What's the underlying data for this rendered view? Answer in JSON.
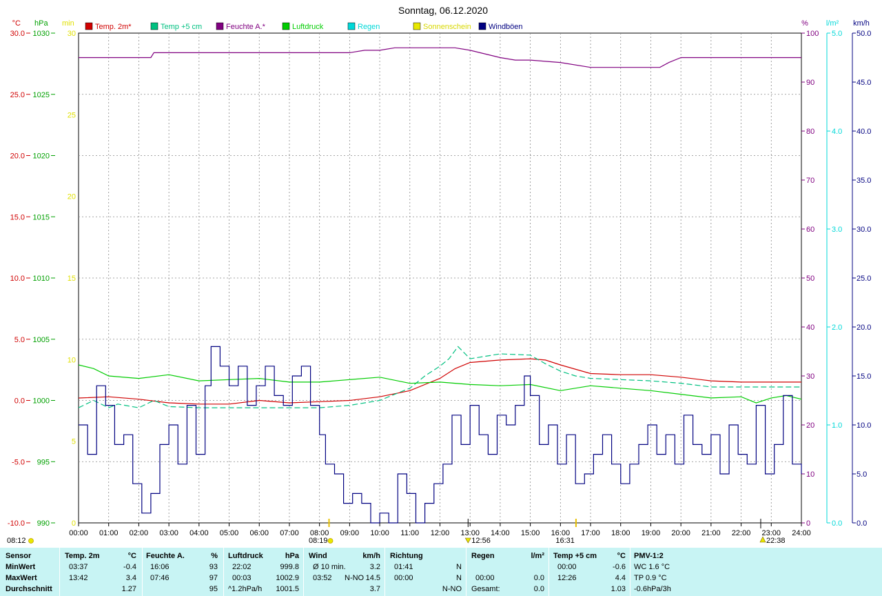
{
  "chart_data": {
    "type": "line",
    "title": "Sonntag, 06.12.2020",
    "legend": [
      {
        "name": "Temp. 2m*",
        "color": "#d00000"
      },
      {
        "name": "Temp +5 cm",
        "color": "#00c080"
      },
      {
        "name": "Feuchte A.*",
        "color": "#800080"
      },
      {
        "name": "Luftdruck",
        "color": "#00cc00"
      },
      {
        "name": "Regen",
        "color": "#00d8d8"
      },
      {
        "name": "Sonnenschein",
        "color": "#e8e800"
      },
      {
        "name": "Windböen",
        "color": "#000080"
      }
    ],
    "axes": {
      "temp": {
        "unit": "°C",
        "color": "#d00000",
        "min": -10,
        "max": 30,
        "ticks": [
          "30.0",
          "25.0",
          "20.0",
          "15.0",
          "10.0",
          "5.0",
          "0.0",
          "-5.0",
          "-10.0"
        ]
      },
      "pressure": {
        "unit": "hPa",
        "color": "#00a000",
        "min": 990,
        "max": 1030,
        "ticks": [
          "1030",
          "1025",
          "1020",
          "1015",
          "1010",
          "1005",
          "1000",
          "995",
          "990"
        ]
      },
      "sunshine": {
        "unit": "min",
        "color": "#e0e000",
        "min": 0,
        "max": 30,
        "ticks": [
          "30",
          "25",
          "20",
          "15",
          "10",
          "5",
          "0"
        ]
      },
      "humidity": {
        "unit": "%",
        "color": "#800080",
        "min": 0,
        "max": 100,
        "ticks": [
          "100",
          "90",
          "80",
          "70",
          "60",
          "50",
          "40",
          "30",
          "20",
          "10",
          "0"
        ]
      },
      "rain": {
        "unit": "l/m²",
        "color": "#00d8d8",
        "min": 0,
        "max": 5,
        "ticks": [
          "5.0",
          "4.0",
          "3.0",
          "2.0",
          "1.0",
          "0.0"
        ]
      },
      "wind": {
        "unit": "km/h",
        "color": "#000080",
        "min": 0,
        "max": 50,
        "ticks": [
          "50.0",
          "45.0",
          "40.0",
          "35.0",
          "30.0",
          "25.0",
          "20.0",
          "15.0",
          "10.0",
          "5.0",
          "0.0"
        ]
      }
    },
    "x_ticks": [
      "00:00",
      "01:00",
      "02:00",
      "03:00",
      "04:00",
      "05:00",
      "06:00",
      "07:00",
      "08:00",
      "09:00",
      "10:00",
      "11:00",
      "12:00",
      "13:00",
      "14:00",
      "15:00",
      "16:00",
      "17:00",
      "18:00",
      "19:00",
      "20:00",
      "21:00",
      "22:00",
      "23:00",
      "24:00"
    ],
    "markers": {
      "sunrise": "08:19",
      "noon": "12:56",
      "sunset": "16:31",
      "moonrise": "22:38",
      "left_label": "08:12"
    },
    "series": [
      {
        "name": "Temp. 2m*",
        "axis": "temp",
        "color": "#d00000",
        "x": [
          0,
          1,
          2,
          3,
          4,
          5,
          6,
          7,
          8,
          9,
          10,
          11,
          12,
          12.5,
          13,
          14,
          15,
          15.5,
          16,
          17,
          18,
          19,
          20,
          21,
          22,
          23,
          24
        ],
        "y": [
          0.2,
          0.3,
          0.1,
          -0.2,
          -0.3,
          -0.3,
          0.0,
          -0.2,
          -0.1,
          0.0,
          0.3,
          0.8,
          1.8,
          2.6,
          3.1,
          3.3,
          3.4,
          3.3,
          2.9,
          2.2,
          2.1,
          2.1,
          1.9,
          1.6,
          1.5,
          1.5,
          1.5
        ]
      },
      {
        "name": "Temp +5 cm",
        "axis": "temp",
        "color": "#00c080",
        "dashed": true,
        "x": [
          0,
          0.5,
          1,
          1.3,
          2,
          2.5,
          3,
          4,
          5,
          6,
          7,
          8,
          9,
          10,
          10.5,
          11,
          11.5,
          12,
          12.3,
          12.6,
          13,
          14,
          15,
          15.5,
          16,
          16.5,
          17,
          18,
          19,
          20,
          21,
          22,
          23,
          24
        ],
        "y": [
          -0.6,
          0.0,
          -0.6,
          -0.3,
          -0.6,
          0.0,
          -0.5,
          -0.6,
          -0.6,
          -0.6,
          -0.6,
          -0.6,
          -0.4,
          0.0,
          0.5,
          1.0,
          2.0,
          2.8,
          3.4,
          4.4,
          3.4,
          3.8,
          3.7,
          3.0,
          2.4,
          2.0,
          1.8,
          1.7,
          1.6,
          1.4,
          1.1,
          1.1,
          1.1,
          1.1
        ]
      },
      {
        "name": "Feuchte A.*",
        "axis": "humidity",
        "color": "#800080",
        "x": [
          0,
          1,
          2,
          2.4,
          2.5,
          3,
          4,
          5,
          6,
          7,
          8,
          9,
          9.5,
          10,
          10.5,
          11,
          12,
          12.5,
          13,
          14,
          14.5,
          15,
          16,
          17,
          18,
          19,
          19.3,
          19.6,
          20,
          21,
          22,
          23,
          24
        ],
        "y": [
          95,
          95,
          95,
          95,
          96,
          96,
          96,
          96,
          96,
          96,
          96,
          96,
          96.5,
          96.5,
          97,
          97,
          97,
          97,
          96.5,
          95,
          94.5,
          94.5,
          94,
          93,
          93,
          93,
          93,
          94,
          95,
          95,
          95,
          95,
          95
        ]
      },
      {
        "name": "Luftdruck",
        "axis": "pressure",
        "color": "#00cc00",
        "x": [
          0,
          0.5,
          1,
          2,
          3,
          4,
          5,
          6,
          7,
          8,
          9,
          10,
          11,
          12,
          13,
          14,
          15,
          16,
          17,
          18,
          19,
          20,
          21,
          22,
          22.5,
          23,
          23.5,
          24
        ],
        "y": [
          1002.9,
          1002.6,
          1002.0,
          1001.8,
          1002.1,
          1001.6,
          1001.7,
          1001.8,
          1001.5,
          1001.5,
          1001.7,
          1001.9,
          1001.4,
          1001.5,
          1001.3,
          1001.2,
          1001.3,
          1000.8,
          1001.2,
          1001.0,
          1000.8,
          1000.5,
          1000.2,
          1000.3,
          999.8,
          1000.2,
          1000.4,
          1000.1
        ]
      },
      {
        "name": "Windböen",
        "axis": "wind",
        "color": "#000080",
        "x": [
          0,
          0.3,
          0.6,
          0.9,
          1.2,
          1.5,
          1.8,
          2.1,
          2.4,
          2.7,
          3.0,
          3.3,
          3.6,
          3.9,
          4.2,
          4.4,
          4.7,
          5.0,
          5.3,
          5.6,
          5.9,
          6.2,
          6.5,
          6.8,
          7.1,
          7.4,
          7.7,
          8.0,
          8.2,
          8.5,
          8.8,
          9.1,
          9.4,
          9.7,
          10.0,
          10.3,
          10.6,
          10.9,
          11.2,
          11.5,
          11.8,
          12.1,
          12.4,
          12.7,
          13.0,
          13.3,
          13.6,
          13.9,
          14.2,
          14.5,
          14.8,
          15.0,
          15.3,
          15.6,
          15.9,
          16.2,
          16.5,
          16.8,
          17.1,
          17.4,
          17.7,
          18.0,
          18.3,
          18.6,
          18.9,
          19.2,
          19.5,
          19.8,
          20.1,
          20.4,
          20.7,
          21.0,
          21.3,
          21.6,
          21.9,
          22.2,
          22.5,
          22.8,
          23.1,
          23.4,
          23.7,
          24.0
        ],
        "y": [
          10,
          7,
          14,
          12,
          8,
          9,
          4,
          1,
          3,
          8,
          10,
          6,
          12,
          7,
          14,
          18,
          16,
          14,
          16,
          12,
          14,
          16,
          13,
          12,
          15,
          16,
          12,
          9,
          6,
          5,
          2,
          3,
          2,
          0,
          1,
          0,
          5,
          3,
          0,
          2,
          4,
          6,
          11,
          8,
          12,
          9,
          7,
          11,
          10,
          12,
          15,
          13,
          8,
          10,
          6,
          9,
          4,
          5,
          7,
          9,
          6,
          4,
          6,
          8,
          10,
          7,
          9,
          6,
          11,
          8,
          7,
          9,
          5,
          10,
          7,
          6,
          12,
          5,
          8,
          13,
          6,
          5
        ]
      }
    ]
  },
  "stats": {
    "headers": {
      "sensor": "Sensor",
      "temp2m": "Temp. 2m",
      "temp_unit": "°C",
      "humidity": "Feuchte A.",
      "humidity_unit": "%",
      "pressure": "Luftdruck",
      "pressure_unit": "hPa",
      "wind": "Wind",
      "wind_unit": "km/h",
      "direction": "Richtung",
      "rain": "Regen",
      "rain_unit": "l/m²",
      "temp5": "Temp +5 cm",
      "temp5_unit": "°C",
      "pmv": "PMV-1:2"
    },
    "rows": {
      "min": "MinWert",
      "max": "MaxWert",
      "avg": "Durchschnitt"
    },
    "temp2m": {
      "min_time": "03:37",
      "min_val": "-0.4",
      "max_time": "13:42",
      "max_val": "3.4",
      "avg": "1.27"
    },
    "humidity": {
      "min_time": "16:06",
      "min_val": "93",
      "max_time": "07:46",
      "max_val": "97",
      "avg": "95"
    },
    "pressure": {
      "min_time": "22:02",
      "min_val": "999.8",
      "max_time": "00:03",
      "max_val": "1002.9",
      "trend": "^1.2hPa/h",
      "avg": "1001.5"
    },
    "wind": {
      "row1_label": "Ø 10 min.",
      "row1_val": "3.2",
      "max_time": "03:52",
      "max_dir": "N-NO",
      "max_val": "14.5",
      "avg": "3.7"
    },
    "direction": {
      "row1_time": "01:41",
      "row1_dir": "N",
      "row2_time": "00:00",
      "row2_dir": "N",
      "avg_dir": "N-NO"
    },
    "rain": {
      "max_time": "00:00",
      "max_val": "0.0",
      "total_label": "Gesamt:",
      "total_val": "0.0"
    },
    "temp5": {
      "min_time": "00:00",
      "min_val": "-0.6",
      "max_time": "12:26",
      "max_val": "4.4",
      "avg": "1.03"
    },
    "pmv": {
      "wc": "WC 1.6 °C",
      "tp": "TP 0.9 °C",
      "trend": "-0.6hPa/3h"
    }
  }
}
